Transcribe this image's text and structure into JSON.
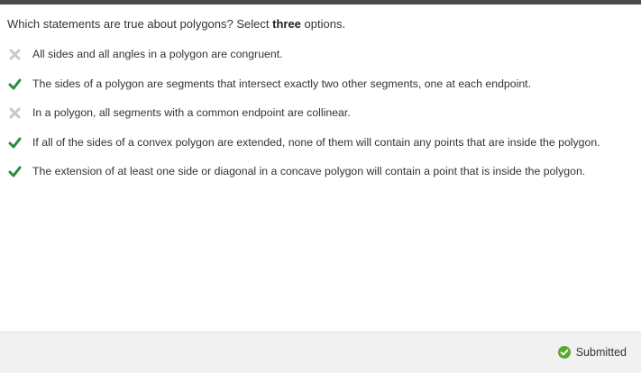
{
  "question": {
    "prefix": "Which statements are true about polygons? Select ",
    "emphasis": "three",
    "suffix": " options."
  },
  "options": [
    {
      "text": "All sides and all angles in a polygon are congruent.",
      "status": "x-icon"
    },
    {
      "text": "The sides of a polygon are segments that intersect exactly two other segments, one at each endpoint.",
      "status": "check-icon"
    },
    {
      "text": "In a polygon, all segments with a common endpoint are collinear.",
      "status": "x-icon"
    },
    {
      "text": "If all of the sides of a convex polygon are extended, none of them will contain any points that are inside the polygon.",
      "status": "check-icon"
    },
    {
      "text": "The extension of at least one side or diagonal in a concave polygon will contain a point that is inside the polygon.",
      "status": "check-icon"
    }
  ],
  "footer": {
    "status_label": "Submitted",
    "status_icon": "check-circle-icon"
  },
  "colors": {
    "check": "#2e8b3a",
    "x": "#c8c8c8",
    "top_bar": "#4a4a4a",
    "footer_bg": "#f1f1f1"
  }
}
